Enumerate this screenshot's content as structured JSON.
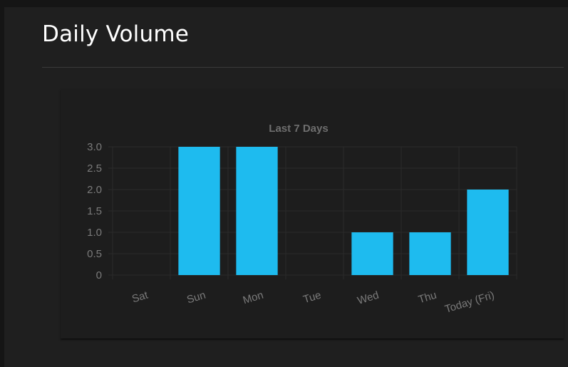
{
  "page": {
    "title": "Daily Volume"
  },
  "colors": {
    "bar": "#1ebbef",
    "grid": "#2a2a2a",
    "tick_text": "#7a7a7a",
    "chart_title": "#6e6e6e"
  },
  "chart_data": {
    "type": "bar",
    "title": "Last 7 Days",
    "categories": [
      "Sat",
      "Sun",
      "Mon",
      "Tue",
      "Wed",
      "Thu",
      "Today (Fri)"
    ],
    "values": [
      0,
      3,
      3,
      0,
      1,
      1,
      2
    ],
    "ylim": [
      0,
      3
    ],
    "yticks": [
      "0",
      "0.5",
      "1.0",
      "1.5",
      "2.0",
      "2.5",
      "3.0"
    ],
    "xlabel": "",
    "ylabel": "",
    "grid": true,
    "legend": "none"
  }
}
